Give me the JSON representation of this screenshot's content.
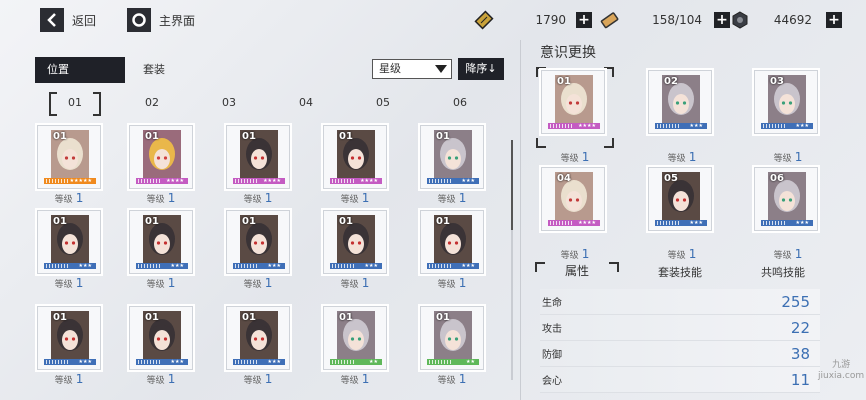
{
  "topbar": {
    "back_label": "返回",
    "home_label": "主界面",
    "resources": [
      {
        "icon": "gold-ticket-icon",
        "value": "1790"
      },
      {
        "icon": "stamina-battery-icon",
        "value": "158/104"
      },
      {
        "icon": "coin-icon",
        "value": "44692"
      }
    ]
  },
  "left": {
    "tabs": [
      "位置",
      "套装"
    ],
    "sort_value": "星级",
    "order_label": "降序↓",
    "slots": [
      "01",
      "02",
      "03",
      "04",
      "05",
      "06"
    ],
    "level_label": "等级",
    "cards": [
      {
        "num": "01",
        "level": "1",
        "rarity": "orange",
        "stars": "★★★★★",
        "char": "blonde"
      },
      {
        "num": "01",
        "level": "1",
        "rarity": "purple",
        "stars": "★★★★",
        "char": "gold"
      },
      {
        "num": "01",
        "level": "1",
        "rarity": "purple",
        "stars": "★★★★",
        "char": "dark"
      },
      {
        "num": "01",
        "level": "1",
        "rarity": "purple",
        "stars": "★★★★",
        "char": "dark"
      },
      {
        "num": "01",
        "level": "1",
        "rarity": "blue",
        "stars": "★★★",
        "char": "silver"
      },
      {
        "num": "01",
        "level": "1",
        "rarity": "blue",
        "stars": "★★★",
        "char": "dark"
      },
      {
        "num": "01",
        "level": "1",
        "rarity": "blue",
        "stars": "★★★",
        "char": "dark"
      },
      {
        "num": "01",
        "level": "1",
        "rarity": "blue",
        "stars": "★★★",
        "char": "dark"
      },
      {
        "num": "01",
        "level": "1",
        "rarity": "blue",
        "stars": "★★★",
        "char": "dark"
      },
      {
        "num": "01",
        "level": "1",
        "rarity": "blue",
        "stars": "★★★",
        "char": "dark"
      },
      {
        "num": "01",
        "level": "1",
        "rarity": "blue",
        "stars": "★★★",
        "char": "dark"
      },
      {
        "num": "01",
        "level": "1",
        "rarity": "blue",
        "stars": "★★★",
        "char": "dark"
      },
      {
        "num": "01",
        "level": "1",
        "rarity": "blue",
        "stars": "★★★",
        "char": "dark"
      },
      {
        "num": "01",
        "level": "1",
        "rarity": "green",
        "stars": "★★",
        "char": "silver"
      },
      {
        "num": "01",
        "level": "1",
        "rarity": "green",
        "stars": "★★",
        "char": "silver"
      }
    ]
  },
  "right": {
    "title": "意识更换",
    "level_label": "等级",
    "equipped": [
      {
        "num": "01",
        "level": "1",
        "rarity": "purple",
        "stars": "★★★★",
        "char": "blonde"
      },
      {
        "num": "02",
        "level": "1",
        "rarity": "blue",
        "stars": "★★★",
        "char": "silver"
      },
      {
        "num": "03",
        "level": "1",
        "rarity": "blue",
        "stars": "★★★",
        "char": "silver"
      },
      {
        "num": "04",
        "level": "1",
        "rarity": "purple",
        "stars": "★★★★",
        "char": "blonde"
      },
      {
        "num": "05",
        "level": "1",
        "rarity": "blue",
        "stars": "★★★",
        "char": "dark"
      },
      {
        "num": "06",
        "level": "1",
        "rarity": "blue",
        "stars": "★★★",
        "char": "silver"
      }
    ],
    "subtabs": [
      "属性",
      "套装技能",
      "共鸣技能"
    ],
    "stats": [
      {
        "name": "生命",
        "value": "255"
      },
      {
        "name": "攻击",
        "value": "22"
      },
      {
        "name": "防御",
        "value": "38"
      },
      {
        "name": "会心",
        "value": "11"
      }
    ]
  },
  "colors": {
    "orange": "#f08a1e",
    "purple": "#c45bc2",
    "blue": "#3f6fb7",
    "green": "#5fb85a",
    "accent": "#3c6fb3"
  },
  "watermark": {
    "line1": "九游",
    "line2": "jiuxia.com"
  }
}
